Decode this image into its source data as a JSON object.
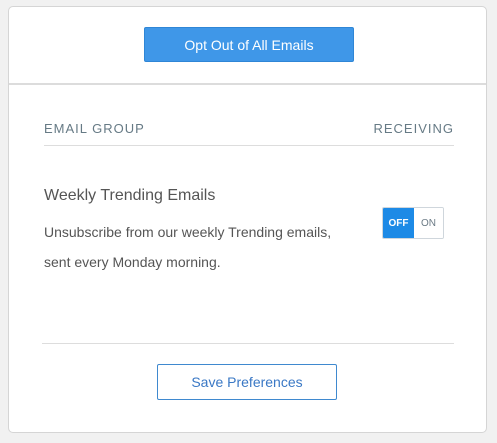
{
  "header": {
    "opt_out_label": "Opt Out of All Emails"
  },
  "table": {
    "col_group": "EMAIL GROUP",
    "col_receiving": "RECEIVING"
  },
  "groups": [
    {
      "title": "Weekly Trending Emails",
      "description": "Unsubscribe from our weekly Trending emails, sent every Monday morning.",
      "toggle": {
        "off_label": "OFF",
        "on_label": "ON",
        "state": "off"
      }
    }
  ],
  "footer": {
    "save_label": "Save Preferences"
  },
  "colors": {
    "primary": "#3f97e8",
    "toggle_active": "#1d8ae6",
    "save_border": "#3f89cf"
  }
}
